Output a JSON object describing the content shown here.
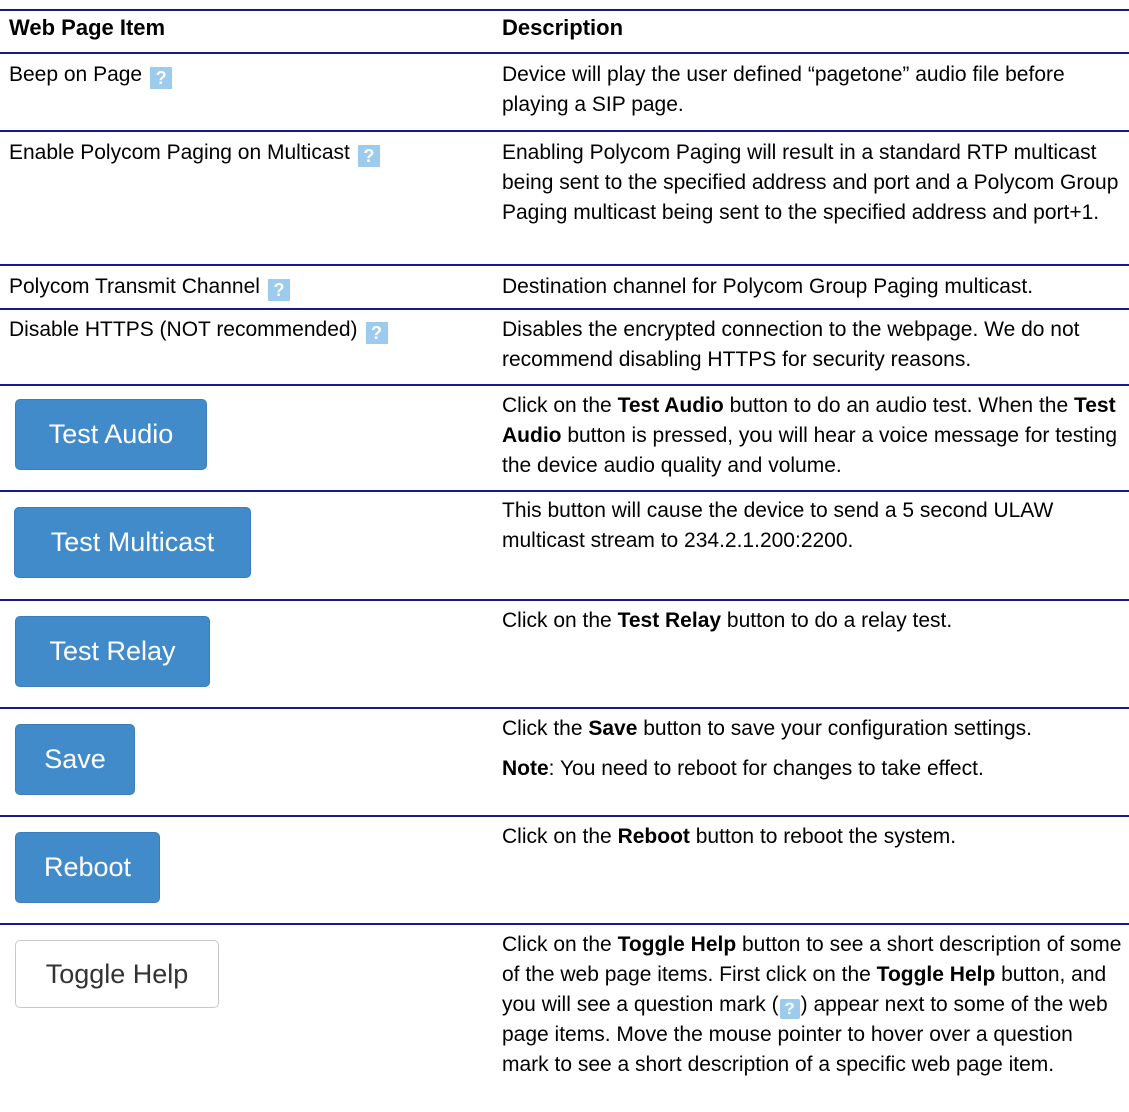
{
  "header": {
    "item": "Web Page Item",
    "description": "Description"
  },
  "rows": [
    {
      "item": "Beep on Page",
      "help_icon": "question-mark",
      "description": "Device will play the user defined “pagetone” audio file before playing a SIP page."
    },
    {
      "item": "Enable Polycom Paging on Multicast",
      "help_icon": "question-mark",
      "description": "Enabling Polycom Paging will result in a standard RTP multicast being sent to the specified address and port and a Polycom Group Paging multicast being sent to the specified address and port+1."
    },
    {
      "item": "Polycom Transmit Channel",
      "help_icon": "question-mark",
      "description": "Destination channel for Polycom Group Paging multicast."
    },
    {
      "item": "Disable HTTPS (NOT recommended)",
      "help_icon": "question-mark",
      "description": "Disables the encrypted connection to the webpage. We do not recommend disabling HTTPS for security reasons."
    }
  ],
  "buttons": {
    "test_audio": {
      "label": "Test Audio",
      "d1": "Click on the ",
      "b1": "Test Audio",
      "d2": " button to do an audio test. When the ",
      "b2": "Test Audio",
      "d3": " button is pressed, you will hear a voice message for testing the device audio quality and volume."
    },
    "test_multicast": {
      "label": "Test Multicast",
      "d1": "This button will cause the device to send a 5 second ULAW multicast stream to 234.2.1.200:2200."
    },
    "test_relay": {
      "label": "Test Relay",
      "d1": "Click on the ",
      "b1": "Test Relay",
      "d2": " button to do a relay test."
    },
    "save": {
      "label": "Save",
      "d1": "Click the ",
      "b1": "Save",
      "d2": " button to save your configuration settings.",
      "note_bold": "Note",
      "note_text": ": You need to reboot for changes to take effect."
    },
    "reboot": {
      "label": "Reboot",
      "d1": "Click on the ",
      "b1": "Reboot",
      "d2": " button to reboot the system."
    },
    "toggle_help": {
      "label": "Toggle Help",
      "d1": "Click on the ",
      "b1": "Toggle Help",
      "d2": " button to see a short description of some of the web page items. First click on the ",
      "b2": "Toggle Help",
      "d3": " button, and you will see a question mark (",
      "d4": ") appear next to some of the web page items. Move the mouse pointer to hover over a question mark to see a short description of a specific web page item."
    }
  },
  "icon_glyph": "?",
  "colors": {
    "rule": "#1a1a8c",
    "primary_button": "#428bca",
    "help_icon": "#9ccbee"
  }
}
